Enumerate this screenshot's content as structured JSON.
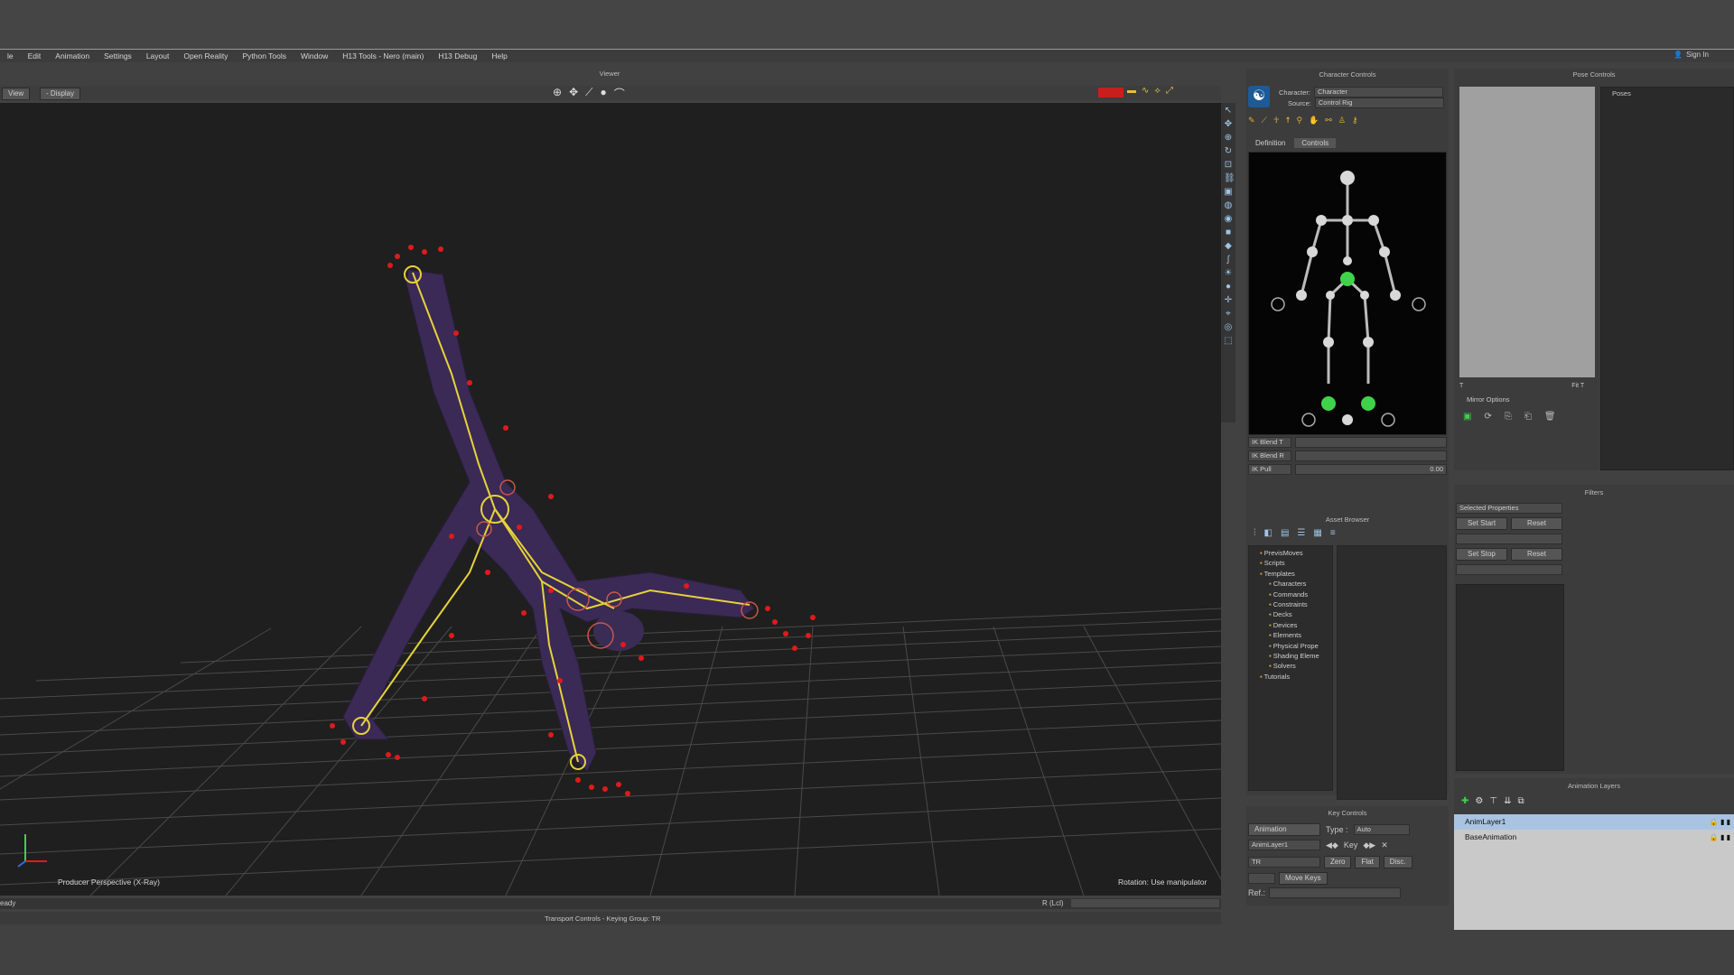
{
  "menu": [
    "le",
    "Edit",
    "Animation",
    "Settings",
    "Layout",
    "Open Reality",
    "Python Tools",
    "Window",
    "H13 Tools - Nero (main)",
    "H13 Debug",
    "Help"
  ],
  "signin": "Sign In",
  "viewer": {
    "title": "Viewer",
    "view_btn": "View",
    "display_btn": "- Display",
    "perspective_label": "Producer Perspective (X-Ray)",
    "rotation_label": "Rotation: Use manipulator"
  },
  "status": {
    "ready": "eady",
    "r_lcl": "R (Lcl)",
    "transport": "Transport Controls  -  Keying Group: TR"
  },
  "character_controls": {
    "title": "Character Controls",
    "character_label": "Character:",
    "character_value": "Character",
    "source_label": "Source:",
    "source_value": "Control Rig",
    "tab_definition": "Definition",
    "tab_controls": "Controls",
    "ik_blend_t": "IK Blend T",
    "ik_blend_r": "IK Blend R",
    "ik_pull": "IK Pull",
    "ik_pull_value": "0.00"
  },
  "asset_browser": {
    "title": "Asset Browser",
    "tree": [
      "PrevisMoves",
      "Scripts",
      "Templates",
      "Characters",
      "Commands",
      "Constraints",
      "Decks",
      "Devices",
      "Elements",
      "Physical Prope",
      "Shading Eleme",
      "Solvers",
      "Tutorials"
    ]
  },
  "key_controls": {
    "title": "Key Controls",
    "animation": "Animation",
    "type_label": "Type :",
    "type_value": "Auto",
    "layer": "AnimLayer1",
    "key_btn": "Key",
    "tr": "TR",
    "zero": "Zero",
    "flat": "Flat",
    "disc": "Disc.",
    "move_keys": "Move Keys",
    "ref": "Ref.:"
  },
  "pose_controls": {
    "title": "Pose Controls",
    "poses": "Poses",
    "mirror": "Mirror Options",
    "tx": "T",
    "fit": "Fit T"
  },
  "filters": {
    "title": "Filters",
    "selected": "Selected Properties",
    "set_start": "Set Start",
    "set_stop": "Set Stop",
    "reset": "Reset"
  },
  "animation_layers": {
    "title": "Animation Layers",
    "layers": [
      "AnimLayer1",
      "BaseAnimation"
    ]
  },
  "colors": {
    "accent": "#9db8d8",
    "green": "#3fd24a",
    "joint": "#e6d23a",
    "marker": "#e01a1a"
  }
}
